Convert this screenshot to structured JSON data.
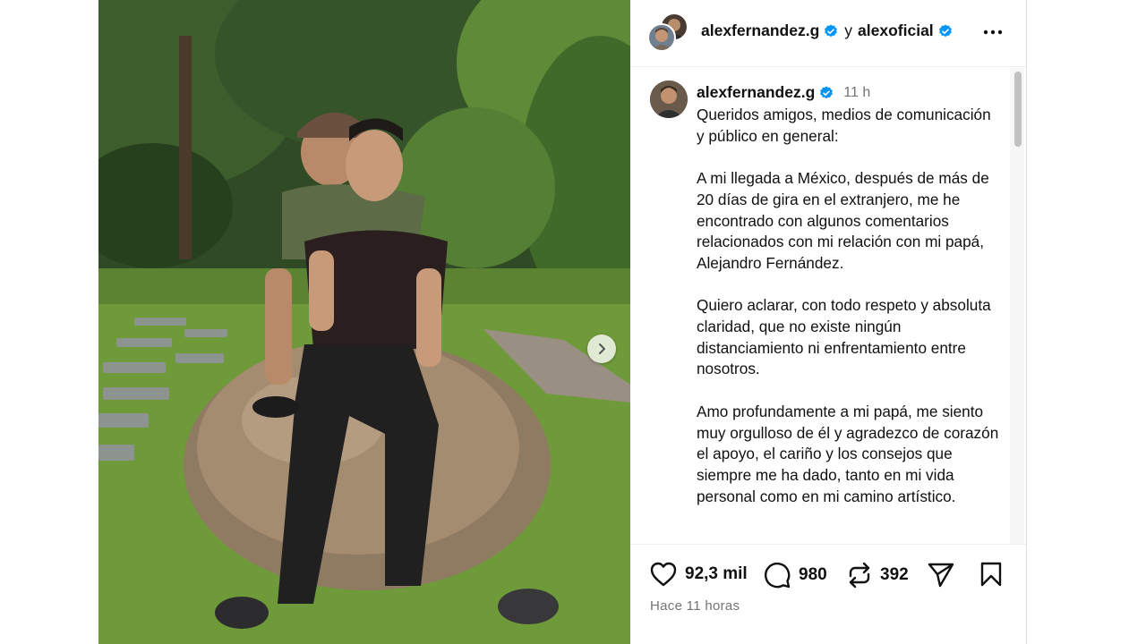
{
  "post": {
    "header": {
      "author": "alexfernandez.g",
      "joiner": "y",
      "coauthor": "alexoficial"
    },
    "caption": {
      "author": "alexfernandez.g",
      "time": "11 h",
      "paragraphs": [
        "Queridos amigos, medios de comunicación y público en general:",
        "A mi llegada a México, después de más de 20 días de gira en el extranjero, me he encontrado con algunos comentarios relacionados con mi relación con mi papá, Alejandro Fernández.",
        "Quiero aclarar, con todo respeto y absoluta claridad, que no existe ningún distanciamiento ni enfrentamiento entre nosotros.",
        "Amo profundamente a mi papá, me siento muy orgulloso de él y agradezco de corazón el apoyo, el cariño y los consejos que siempre me ha dado, tanto en mi vida personal como en mi camino artístico."
      ]
    },
    "actions": {
      "likes": "92,3 mil",
      "comments": "980",
      "reposts": "392"
    },
    "timestamp": "Hace 11 horas",
    "icons": {
      "verified": "verified-badge-icon",
      "more": "more-options-icon",
      "like": "heart-icon",
      "comment": "comment-icon",
      "repost": "repost-icon",
      "share": "share-icon",
      "save": "bookmark-icon",
      "next": "chevron-right-icon"
    },
    "colors": {
      "verified": "#0095f6",
      "text": "#111111",
      "muted": "#737373"
    }
  }
}
